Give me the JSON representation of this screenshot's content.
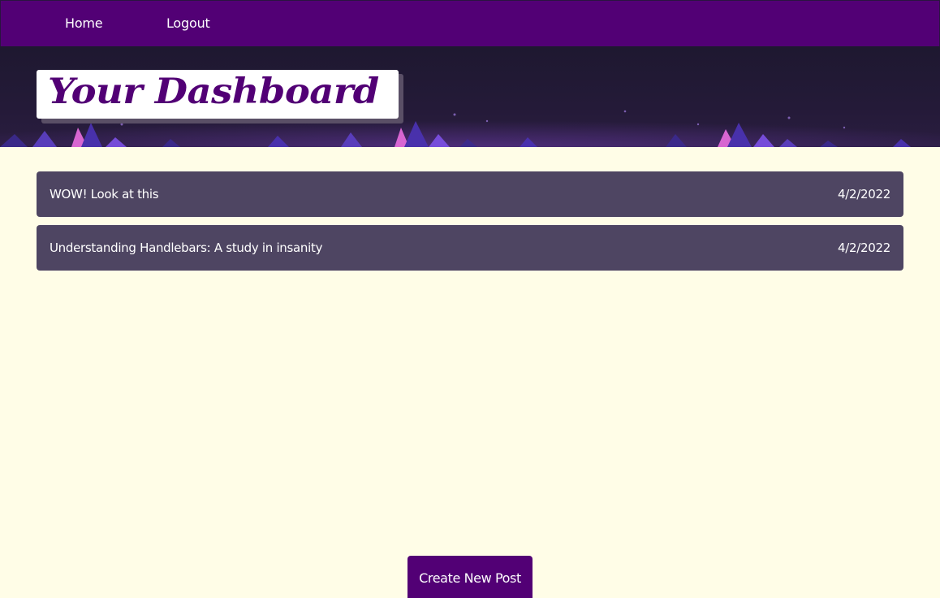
{
  "nav": {
    "home_label": "Home",
    "logout_label": "Logout"
  },
  "header": {
    "title": "Your Dashboard"
  },
  "posts": [
    {
      "title": "WOW! Look at this",
      "date": "4/2/2022"
    },
    {
      "title": "Understanding Handlebars: A study in insanity",
      "date": "4/2/2022"
    }
  ],
  "actions": {
    "create_label": "Create New Post"
  },
  "colors": {
    "brand_purple": "#520075",
    "post_row": "#4e4562",
    "page_background": "#fffde7",
    "banner_dark": "#1e1830"
  }
}
